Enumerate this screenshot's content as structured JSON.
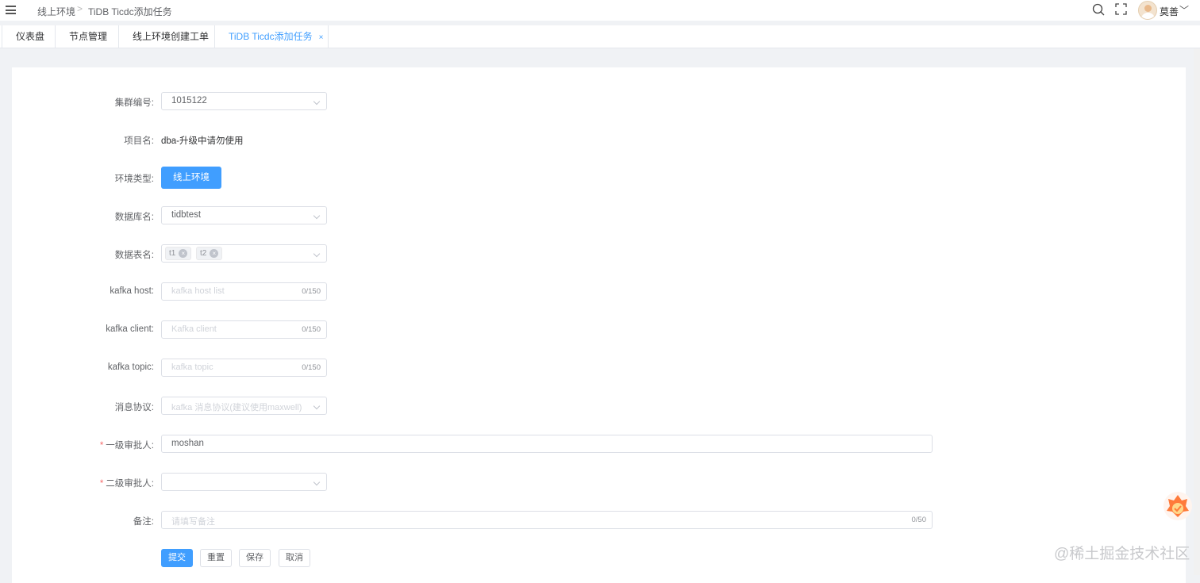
{
  "breadcrumb": [
    "线上环境",
    "TiDB Ticdc添加任务"
  ],
  "header": {
    "user_name": "莫善"
  },
  "tabs": [
    {
      "label": "仪表盘"
    },
    {
      "label": "节点管理"
    },
    {
      "label": "线上环境创建工单"
    },
    {
      "label": "TiDB Ticdc添加任务",
      "active": true,
      "close": "×"
    }
  ],
  "form": {
    "cluster": {
      "label": "集群编号:",
      "value": "1015122"
    },
    "project": {
      "label": "项目名:",
      "value": "dba-升级中请勿使用"
    },
    "env": {
      "label": "环境类型:",
      "value": "线上环境"
    },
    "db": {
      "label": "数据库名:",
      "value": "tidbtest"
    },
    "tables": {
      "label": "数据表名:",
      "tags": [
        "t1",
        "t2"
      ]
    },
    "kafka_host": {
      "label": "kafka host:",
      "placeholder": "kafka host list",
      "count": "0/150"
    },
    "kafka_client": {
      "label": "kafka client:",
      "placeholder": "Kafka client",
      "count": "0/150"
    },
    "kafka_topic": {
      "label": "kafka topic:",
      "placeholder": "kafka topic",
      "count": "0/150"
    },
    "protocol": {
      "label": "消息协议:",
      "placeholder": "kafka 消息协议(建议使用maxwell)"
    },
    "approver1": {
      "label": "一级审批人:",
      "value": "moshan",
      "required_mark": "*"
    },
    "approver2": {
      "label": "二级审批人:",
      "value": "",
      "required_mark": "*"
    },
    "remark": {
      "label": "备注:",
      "placeholder": "请填写备注",
      "count": "0/50"
    }
  },
  "actions": {
    "submit": "提交",
    "reset": "重置",
    "save": "保存",
    "cancel": "取消"
  },
  "watermark": "@稀土掘金技术社区",
  "colors": {
    "primary": "#409eff",
    "required": "#f56c6c"
  },
  "icons": [
    "menu-icon",
    "search-icon",
    "fullscreen-icon",
    "chevron-down-icon",
    "close-icon",
    "floating-badge-icon"
  ]
}
